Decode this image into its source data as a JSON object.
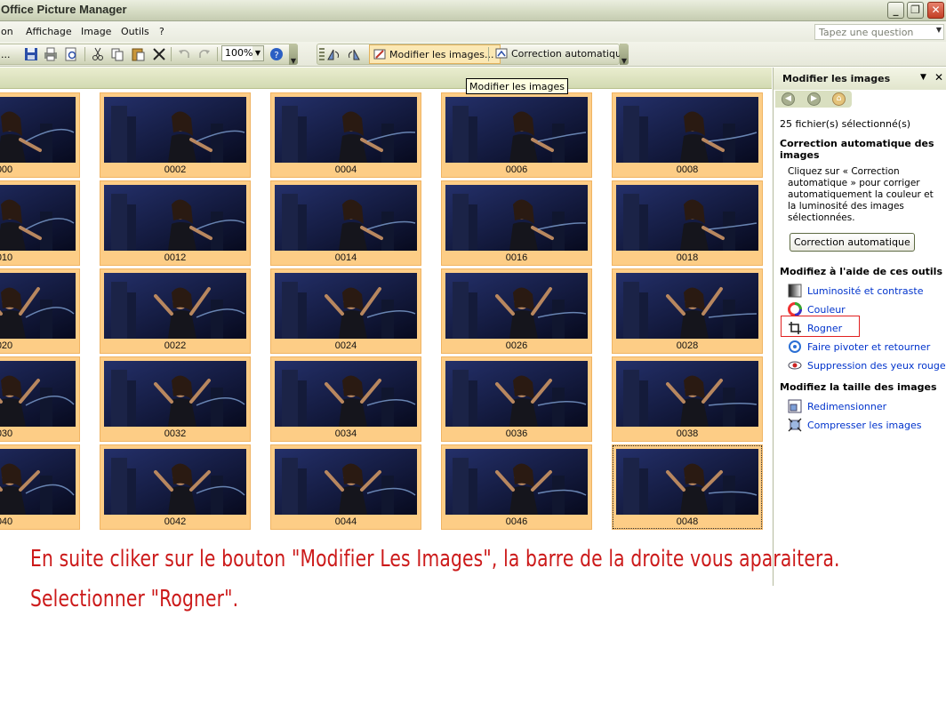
{
  "window": {
    "title": "Office Picture Manager"
  },
  "menu": {
    "items": [
      {
        "label": "on"
      },
      {
        "label": "Affichage"
      },
      {
        "label": "Image"
      },
      {
        "label": "Outils"
      },
      {
        "label": "?"
      }
    ]
  },
  "ask": {
    "placeholder": "Tapez une question"
  },
  "toolbar": {
    "overflow_label": "...",
    "zoom_value": "100%",
    "edit_images_label": "Modifier les images...",
    "auto_correct_label": "Correction automatique"
  },
  "tooltip": {
    "text": "Modifier les images"
  },
  "thumbnails": {
    "labels": [
      "000",
      "0002",
      "0004",
      "0006",
      "0008",
      "010",
      "0012",
      "0014",
      "0016",
      "0018",
      "020",
      "0022",
      "0024",
      "0026",
      "0028",
      "030",
      "0032",
      "0034",
      "0036",
      "0038",
      "040",
      "0042",
      "0044",
      "0046",
      "0048"
    ]
  },
  "pane": {
    "title": "Modifier les images",
    "selection_count": "25 fichier(s) sélectionné(s)",
    "auto_section_title": "Correction automatique des images",
    "auto_section_body": "Cliquez sur « Correction automatique » pour corriger automatiquement la couleur et la luminosité des images sélectionnées.",
    "auto_button": "Correction automatique",
    "tools_section_title": "Modifiez à l'aide de ces outils",
    "tools": [
      {
        "label": "Luminosité et contraste",
        "icon": "brightness-icon"
      },
      {
        "label": "Couleur",
        "icon": "color-icon"
      },
      {
        "label": "Rogner",
        "icon": "crop-icon"
      },
      {
        "label": "Faire pivoter et retourner",
        "icon": "rotate-icon"
      },
      {
        "label": "Suppression des yeux rouges",
        "icon": "red-eye-icon"
      }
    ],
    "size_section_title": "Modifiez la taille des images",
    "size_tools": [
      {
        "label": "Redimensionner",
        "icon": "resize-icon"
      },
      {
        "label": "Compresser les images",
        "icon": "compress-icon"
      }
    ]
  },
  "annotation": {
    "line1": "En suite cliker sur le bouton \"Modifier Les Images\", la barre de la droite vous aparaitera.",
    "line2": "Selectionner \"Rogner\"."
  },
  "colors": {
    "thumb_bg": "#fdcd86",
    "highlight": "#e02020",
    "annotation": "#cc1a1a",
    "link": "#0033cc"
  }
}
